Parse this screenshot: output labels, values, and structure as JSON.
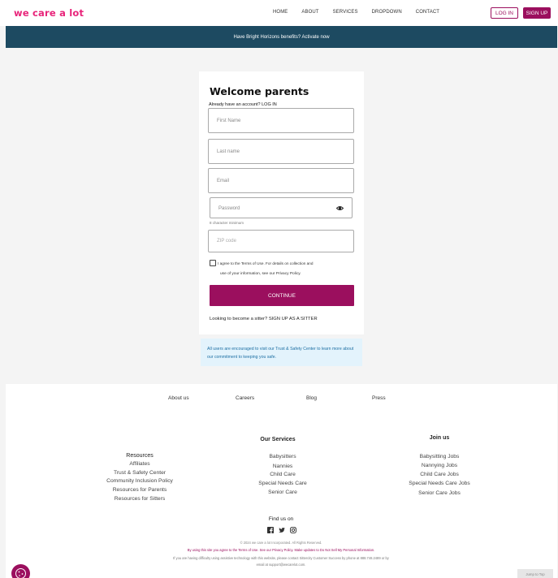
{
  "header": {
    "logo": "we care a lot",
    "nav": [
      "HOME",
      "ABOUT",
      "SERVICES",
      "DROPDOWN",
      "CONTACT"
    ],
    "login_label": "LOG IN",
    "signup_label": "SIGN UP"
  },
  "banner": {
    "text": "Have Bright Horizons benefits? Activate now"
  },
  "form": {
    "title": "Welcome parents",
    "already": "Already have an account? LOG IN",
    "first_name_placeholder": "First Name",
    "last_name_placeholder": "Last name",
    "email_placeholder": "Email",
    "password_placeholder": "Password",
    "password_hint": "8 character minimum",
    "zip_placeholder": "ZIP code",
    "terms_line1": "I agree to the Terms of Use. For details on collection and",
    "terms_line2": "use of your information, see our Privacy Policy.",
    "continue_label": "CONTINUE",
    "sitter_text": "Looking to become a sitter? SIGN UP AS A SITTER"
  },
  "notice": {
    "text": "All users are encouraged to visit our Trust & Safety Center to learn more about our commitment to keeping you safe."
  },
  "footer": {
    "links": [
      "About us",
      "Careers",
      "Blog",
      "Press"
    ],
    "resources": {
      "title": "Resources",
      "items": [
        "Affiliates",
        "Trust & Safety Center",
        "Community Inclusion Policy",
        "Resources for Parents",
        "Resources for Sitters"
      ]
    },
    "services": {
      "title": "Our Services",
      "items": [
        "Babysitters",
        "Nannies",
        "Child Care",
        "Special Needs Care",
        "Senior Care"
      ]
    },
    "join": {
      "title": "Join us",
      "items": [
        "Babysitting Jobs",
        "Nannying Jobs",
        "Child Care Jobs",
        "Special Needs Care Jobs",
        "Senior Care Jobs"
      ]
    },
    "find_us": "Find us on",
    "copyright": "© 2024 we care a lot Incorporated. All Rights Reserved.",
    "agree_text": "By using this site you agree to the Terms of Use. See our Privacy Policy. Make updates to Do Not Sell My Personal Information.",
    "assist_text": "If you are having difficulty using assistive technology with this website, please contact Sittercity Customer Success by phone at 888.748.2489 or by",
    "email_text": "email at support@wecarelot.com.",
    "jump_label": "Jump to Top"
  },
  "colors": {
    "brand": "#e8247a",
    "primary": "#9b0f5e",
    "banner": "#1d4a61",
    "notice_bg": "#e3f3fc"
  }
}
